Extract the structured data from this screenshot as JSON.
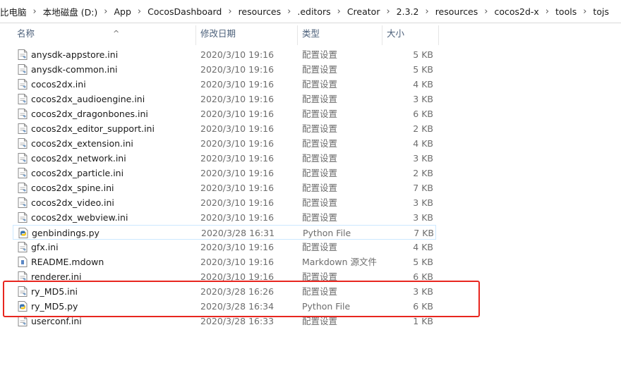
{
  "breadcrumb": [
    "比电脑",
    "本地磁盘 (D:)",
    "App",
    "CocosDashboard",
    "resources",
    ".editors",
    "Creator",
    "2.3.2",
    "resources",
    "cocos2d-x",
    "tools",
    "tojs"
  ],
  "breadcrumb_separator": "›",
  "columns": {
    "name": "名称",
    "date": "修改日期",
    "type": "类型",
    "size": "大小"
  },
  "sort_indicator": "^",
  "files": [
    {
      "name": "anysdk-appstore.ini",
      "date": "2020/3/10 19:16",
      "type": "配置设置",
      "size": "5 KB",
      "icon": "ini-file-icon"
    },
    {
      "name": "anysdk-common.ini",
      "date": "2020/3/10 19:16",
      "type": "配置设置",
      "size": "5 KB",
      "icon": "ini-file-icon"
    },
    {
      "name": "cocos2dx.ini",
      "date": "2020/3/10 19:16",
      "type": "配置设置",
      "size": "4 KB",
      "icon": "ini-file-icon"
    },
    {
      "name": "cocos2dx_audioengine.ini",
      "date": "2020/3/10 19:16",
      "type": "配置设置",
      "size": "3 KB",
      "icon": "ini-file-icon"
    },
    {
      "name": "cocos2dx_dragonbones.ini",
      "date": "2020/3/10 19:16",
      "type": "配置设置",
      "size": "6 KB",
      "icon": "ini-file-icon"
    },
    {
      "name": "cocos2dx_editor_support.ini",
      "date": "2020/3/10 19:16",
      "type": "配置设置",
      "size": "2 KB",
      "icon": "ini-file-icon"
    },
    {
      "name": "cocos2dx_extension.ini",
      "date": "2020/3/10 19:16",
      "type": "配置设置",
      "size": "4 KB",
      "icon": "ini-file-icon"
    },
    {
      "name": "cocos2dx_network.ini",
      "date": "2020/3/10 19:16",
      "type": "配置设置",
      "size": "3 KB",
      "icon": "ini-file-icon"
    },
    {
      "name": "cocos2dx_particle.ini",
      "date": "2020/3/10 19:16",
      "type": "配置设置",
      "size": "2 KB",
      "icon": "ini-file-icon"
    },
    {
      "name": "cocos2dx_spine.ini",
      "date": "2020/3/10 19:16",
      "type": "配置设置",
      "size": "7 KB",
      "icon": "ini-file-icon"
    },
    {
      "name": "cocos2dx_video.ini",
      "date": "2020/3/10 19:16",
      "type": "配置设置",
      "size": "3 KB",
      "icon": "ini-file-icon"
    },
    {
      "name": "cocos2dx_webview.ini",
      "date": "2020/3/10 19:16",
      "type": "配置设置",
      "size": "3 KB",
      "icon": "ini-file-icon"
    },
    {
      "name": "genbindings.py",
      "date": "2020/3/28 16:31",
      "type": "Python File",
      "size": "7 KB",
      "icon": "python-file-icon",
      "selected": true
    },
    {
      "name": "gfx.ini",
      "date": "2020/3/10 19:16",
      "type": "配置设置",
      "size": "4 KB",
      "icon": "ini-file-icon"
    },
    {
      "name": "README.mdown",
      "date": "2020/3/10 19:16",
      "type": "Markdown 源文件",
      "size": "5 KB",
      "icon": "markdown-file-icon"
    },
    {
      "name": "renderer.ini",
      "date": "2020/3/10 19:16",
      "type": "配置设置",
      "size": "6 KB",
      "icon": "ini-file-icon"
    },
    {
      "name": "ry_MD5.ini",
      "date": "2020/3/28 16:26",
      "type": "配置设置",
      "size": "3 KB",
      "icon": "ini-file-icon"
    },
    {
      "name": "ry_MD5.py",
      "date": "2020/3/28 16:34",
      "type": "Python File",
      "size": "6 KB",
      "icon": "python-file-icon"
    },
    {
      "name": "userconf.ini",
      "date": "2020/3/28 16:33",
      "type": "配置设置",
      "size": "1 KB",
      "icon": "ini-file-icon"
    }
  ],
  "colors": {
    "highlight_box": "#e8261f",
    "header_text": "#4c607a",
    "selection_border": "#cce8ff"
  }
}
